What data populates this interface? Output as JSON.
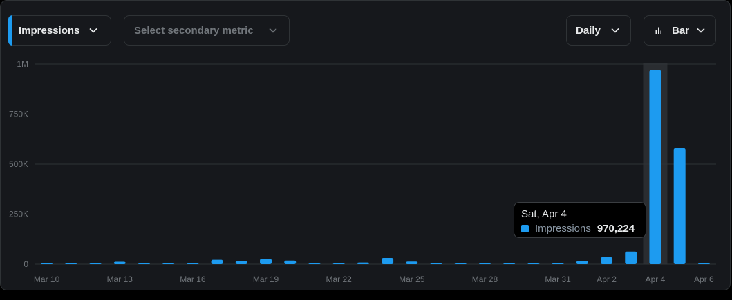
{
  "controls": {
    "primary_metric": "Impressions",
    "secondary_metric_placeholder": "Select secondary metric",
    "period": "Daily",
    "chart_type": "Bar"
  },
  "colors": {
    "bar": "#1d9bf0",
    "hover_column": "#2a2d31",
    "grid": "#2f3336",
    "text_muted": "#71767b"
  },
  "tooltip": {
    "date": "Sat, Apr 4",
    "metric": "Impressions",
    "value": "970,224"
  },
  "chart_data": {
    "type": "bar",
    "categories": [
      "Mar 10",
      "Mar 11",
      "Mar 12",
      "Mar 13",
      "Mar 14",
      "Mar 15",
      "Mar 16",
      "Mar 17",
      "Mar 18",
      "Mar 19",
      "Mar 20",
      "Mar 21",
      "Mar 22",
      "Mar 23",
      "Mar 24",
      "Mar 25",
      "Mar 26",
      "Mar 27",
      "Mar 28",
      "Mar 29",
      "Mar 30",
      "Mar 31",
      "Apr 1",
      "Apr 2",
      "Apr 3",
      "Apr 4",
      "Apr 5",
      "Apr 6"
    ],
    "x_tick_labels": [
      "Mar 10",
      "Mar 13",
      "Mar 16",
      "Mar 19",
      "Mar 22",
      "Mar 25",
      "Mar 28",
      "Mar 31",
      "Apr 2",
      "Apr 4",
      "Apr 6"
    ],
    "series": [
      {
        "name": "Impressions",
        "values": [
          3000,
          3000,
          5000,
          12000,
          7000,
          7000,
          7000,
          22000,
          17000,
          27000,
          18000,
          5000,
          7000,
          8000,
          31000,
          13000,
          4000,
          5000,
          5000,
          4000,
          6000,
          5000,
          16000,
          35000,
          63000,
          970224,
          580000,
          4000
        ]
      }
    ],
    "y_ticks": [
      0,
      250000,
      500000,
      750000,
      1000000
    ],
    "y_tick_labels": [
      "0",
      "250K",
      "500K",
      "750K",
      "1M"
    ],
    "ylim": [
      0,
      1000000
    ],
    "highlighted": "Apr 4",
    "grid": true
  }
}
